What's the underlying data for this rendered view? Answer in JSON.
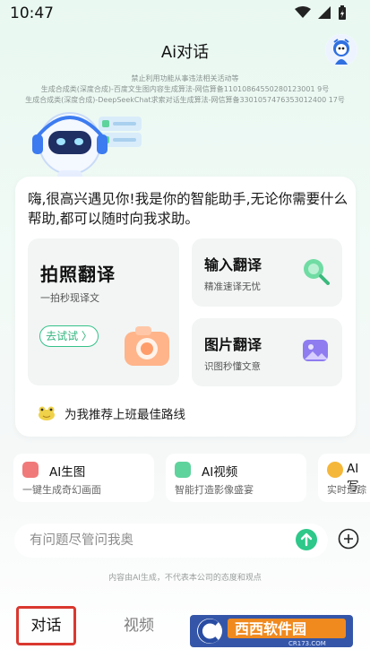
{
  "status_bar": {
    "time": "10:47"
  },
  "header": {
    "title": "Ai对话"
  },
  "notice": {
    "line1": "禁止利用功能从事违法相关活动等",
    "line2": "生成合成类(深度合成)-百度文生图内容生成算法-网信算备11010864550280123001 9号",
    "line3": "生成合成类(深度合成)-DeepSeekChat求索对话生成算法-网信算备3301057476353012400 17号"
  },
  "main_card": {
    "greeting": "嗨,很高兴遇见你!我是你的智能助手,无论你需要什么帮助,都可以随时向我求助。",
    "photo_translate": {
      "title": "拍照翻译",
      "subtitle": "一拍秒现译文",
      "button": "去试试 〉"
    },
    "input_translate": {
      "title": "输入翻译",
      "subtitle": "精准速译无忧"
    },
    "image_translate": {
      "title": "图片翻译",
      "subtitle": "识图秒懂文意"
    },
    "suggestion": "为我推荐上班最佳路线"
  },
  "tools": [
    {
      "title": "AI生图",
      "subtitle": "一键生成奇幻画面",
      "color": "#f07a7a"
    },
    {
      "title": "AI视频",
      "subtitle": "智能打造影像盛宴",
      "color": "#5fd39c"
    },
    {
      "title": "AI写",
      "subtitle": "实时追踪",
      "color": "#f5b73a"
    }
  ],
  "input": {
    "placeholder": "有问题尽管问我奥"
  },
  "disclaimer": "内容由AI生成，不代表本公司的态度和观点",
  "bottom_nav": {
    "tab_chat": "对话",
    "tab_video": "视频"
  },
  "watermark": {
    "text": "西西软件园",
    "sub": "CR173.COM"
  },
  "colors": {
    "accent": "#2dc88a",
    "highlight_border": "#d9382f"
  }
}
